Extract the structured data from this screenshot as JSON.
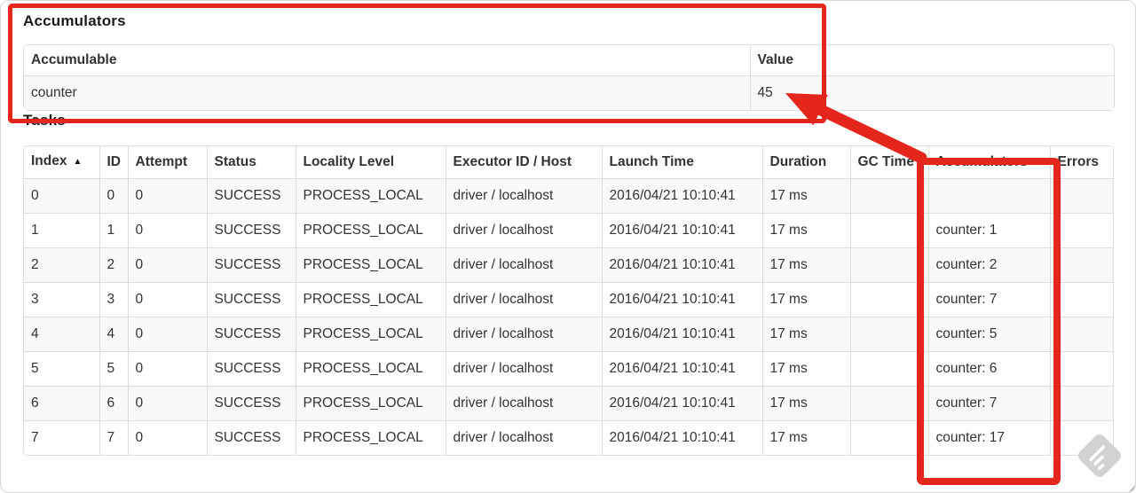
{
  "accumulators": {
    "heading": "Accumulators",
    "columns": [
      "Accumulable",
      "Value"
    ],
    "rows": [
      [
        "counter",
        "45"
      ]
    ]
  },
  "tasks": {
    "heading": "Tasks",
    "sorted_column": "Index",
    "sort_indicator": "▲",
    "columns": [
      "Index",
      "ID",
      "Attempt",
      "Status",
      "Locality Level",
      "Executor ID / Host",
      "Launch Time",
      "Duration",
      "GC Time",
      "Accumulators",
      "Errors"
    ],
    "rows": [
      [
        "0",
        "0",
        "0",
        "SUCCESS",
        "PROCESS_LOCAL",
        "driver / localhost",
        "2016/04/21 10:10:41",
        "17 ms",
        "",
        "",
        ""
      ],
      [
        "1",
        "1",
        "0",
        "SUCCESS",
        "PROCESS_LOCAL",
        "driver / localhost",
        "2016/04/21 10:10:41",
        "17 ms",
        "",
        "counter: 1",
        ""
      ],
      [
        "2",
        "2",
        "0",
        "SUCCESS",
        "PROCESS_LOCAL",
        "driver / localhost",
        "2016/04/21 10:10:41",
        "17 ms",
        "",
        "counter: 2",
        ""
      ],
      [
        "3",
        "3",
        "0",
        "SUCCESS",
        "PROCESS_LOCAL",
        "driver / localhost",
        "2016/04/21 10:10:41",
        "17 ms",
        "",
        "counter: 7",
        ""
      ],
      [
        "4",
        "4",
        "0",
        "SUCCESS",
        "PROCESS_LOCAL",
        "driver / localhost",
        "2016/04/21 10:10:41",
        "17 ms",
        "",
        "counter: 5",
        ""
      ],
      [
        "5",
        "5",
        "0",
        "SUCCESS",
        "PROCESS_LOCAL",
        "driver / localhost",
        "2016/04/21 10:10:41",
        "17 ms",
        "",
        "counter: 6",
        ""
      ],
      [
        "6",
        "6",
        "0",
        "SUCCESS",
        "PROCESS_LOCAL",
        "driver / localhost",
        "2016/04/21 10:10:41",
        "17 ms",
        "",
        "counter: 7",
        ""
      ],
      [
        "7",
        "7",
        "0",
        "SUCCESS",
        "PROCESS_LOCAL",
        "driver / localhost",
        "2016/04/21 10:10:41",
        "17 ms",
        "",
        "counter: 17",
        ""
      ]
    ]
  },
  "colors": {
    "annotation_red": "#e5261c",
    "table_border": "#dddddd",
    "row_stripe": "#f9f9f9",
    "watermark_gray": "#d2d2d2"
  }
}
